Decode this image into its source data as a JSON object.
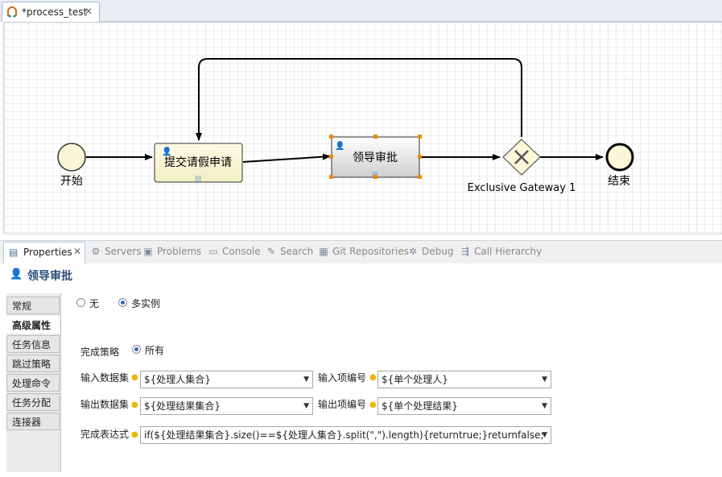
{
  "editor": {
    "tab_title": "*process_test"
  },
  "diagram": {
    "start_label": "开始",
    "task1_label": "提交请假申请",
    "task2_label": "领导审批",
    "gateway_label": "Exclusive Gateway 1",
    "end_label": "结束",
    "multi_instance_marker": "|||"
  },
  "view_tabs": [
    {
      "label": "Properties",
      "icon": "properties-icon"
    },
    {
      "label": "Servers",
      "icon": "servers-icon"
    },
    {
      "label": "Problems",
      "icon": "problems-icon"
    },
    {
      "label": "Console",
      "icon": "console-icon"
    },
    {
      "label": "Search",
      "icon": "search-icon"
    },
    {
      "label": "Git Repositories",
      "icon": "git-icon"
    },
    {
      "label": "Debug",
      "icon": "debug-icon"
    },
    {
      "label": "Call Hierarchy",
      "icon": "call-hierarchy-icon"
    }
  ],
  "properties": {
    "title": "领导审批",
    "left_tabs": [
      "常规",
      "高级属性",
      "任务信息",
      "跳过策略",
      "处理命令",
      "任务分配",
      "连接器"
    ],
    "active_tab": "高级属性",
    "radio_none": "无",
    "radio_multi": "多实例",
    "completion_policy_label": "完成策略",
    "completion_policy_value": "所有",
    "input_collection_label": "输入数据集",
    "input_collection_value": "${处理人集合}",
    "input_item_label": "输入项编号",
    "input_item_value": "${单个处理人}",
    "output_collection_label": "输出数据集",
    "output_collection_value": "${处理结果集合}",
    "output_item_label": "输出项编号",
    "output_item_value": "${单个处理结果}",
    "completion_expr_label": "完成表达式",
    "completion_expr_value": "if(${处理结果集合}.size()==${处理人集合}.split(\",\").length){returntrue;}returnfalse;"
  }
}
